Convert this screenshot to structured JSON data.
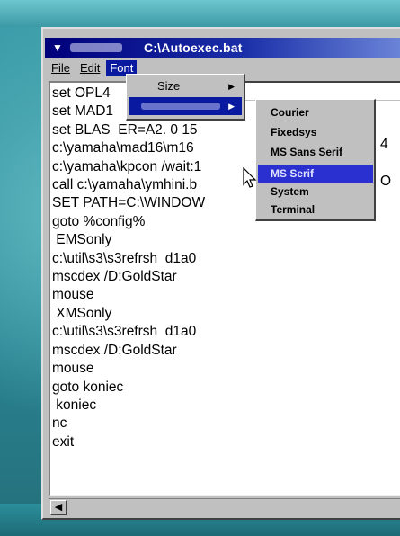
{
  "window": {
    "title": "C:\\Autoexec.bat"
  },
  "menubar": {
    "file": "File",
    "edit": "Edit",
    "font": "Font"
  },
  "font_menu": {
    "size": "Size"
  },
  "typeface_menu": {
    "items": [
      "Courier",
      "Fixedsys",
      "MS Sans Serif",
      "MS Serif",
      "System",
      "Terminal"
    ],
    "selected": "MS Serif"
  },
  "editor": {
    "lines": [
      "set OPL4",
      "set MAD1",
      "set BLAS  ER=A2. 0 15",
      "c:\\yamaha\\mad16\\m16",
      "c:\\yamaha\\kpcon /wait:1",
      "call c:\\yamaha\\ymhini.b",
      "SET PATH=C:\\WINDOW",
      "goto %config%",
      " EMSonly",
      "c:\\util\\s3\\s3refrsh  d1a0",
      "mscdex /D:GoldStar",
      "mouse",
      " XMSonly",
      "c:\\util\\s3\\s3refrsh  d1a0",
      "mscdex /D:GoldStar",
      "mouse",
      "goto koniec",
      " koniec",
      "nc",
      "exit"
    ],
    "edge_chars": {
      "line5": "4",
      "line7": "O"
    }
  },
  "colors": {
    "highlight": "#0a1aa0",
    "title_start": "#00007b",
    "background": "#2f8a96"
  }
}
